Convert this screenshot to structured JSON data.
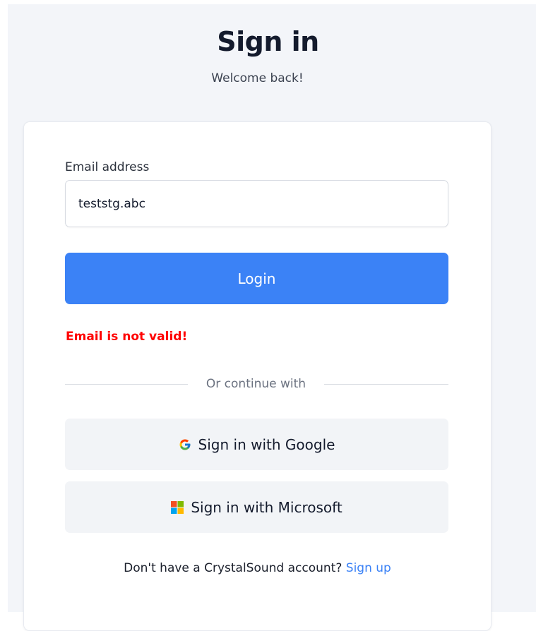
{
  "header": {
    "title": "Sign in",
    "subtitle": "Welcome back!"
  },
  "form": {
    "email_label": "Email address",
    "email_value": "teststg.abc",
    "login_label": "Login",
    "error_message": "Email is not valid!"
  },
  "divider": {
    "text": "Or continue with"
  },
  "sso": {
    "google_label": "Sign in with Google",
    "google_icon": "google-g-icon",
    "microsoft_label": "Sign in with Microsoft",
    "microsoft_icon": "microsoft-squares-icon"
  },
  "footer": {
    "prompt": "Don't have a CrystalSound account?",
    "signup_label": "Sign up"
  },
  "colors": {
    "primary": "#3b82f6",
    "error": "#ff0000",
    "page_background": "#f3f5f9",
    "sso_button_background": "#f2f4f7"
  }
}
